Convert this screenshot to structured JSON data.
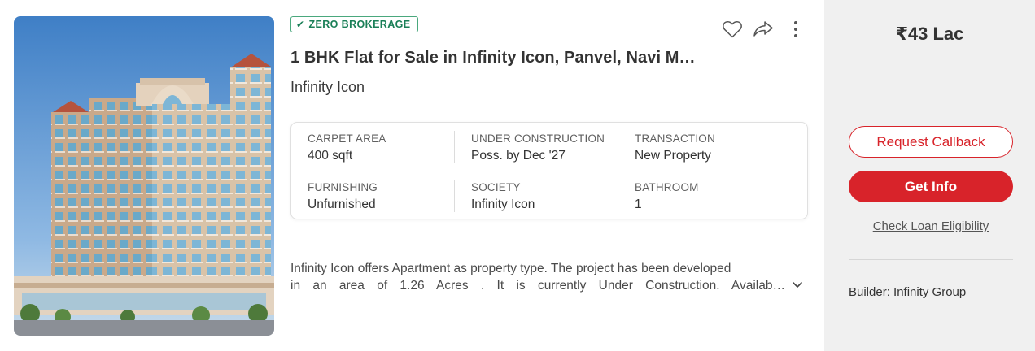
{
  "listing": {
    "badge": "ZERO BROKERAGE",
    "title": "1 BHK Flat for Sale in Infinity Icon, Panvel, Navi M…",
    "society_name": "Infinity Icon",
    "summary": [
      {
        "label": "CARPET AREA",
        "value": "400 sqft"
      },
      {
        "label": "UNDER CONSTRUCTION",
        "value": "Poss. by Dec '27"
      },
      {
        "label": "TRANSACTION",
        "value": "New Property"
      },
      {
        "label": "FURNISHING",
        "value": "Unfurnished"
      },
      {
        "label": "SOCIETY",
        "value": "Infinity Icon"
      },
      {
        "label": "BATHROOM",
        "value": "1"
      }
    ],
    "description_line1": "Infinity Icon offers Apartment as property type. The project has been developed",
    "description_line2": "in an area of 1.26 Acres . It is currently Under Construction. Availab…",
    "icons": [
      "favorite-icon",
      "share-icon",
      "more-options-icon",
      "expand-chevron-icon"
    ]
  },
  "side": {
    "price": "₹43 Lac",
    "request_callback": "Request Callback",
    "get_info": "Get Info",
    "check_loan": "Check Loan Eligibility",
    "builder": "Builder: Infinity Group"
  },
  "colors": {
    "brand_red": "#d8232a",
    "badge_green": "#1a7f57",
    "panel_bg": "#f0f0f0"
  }
}
